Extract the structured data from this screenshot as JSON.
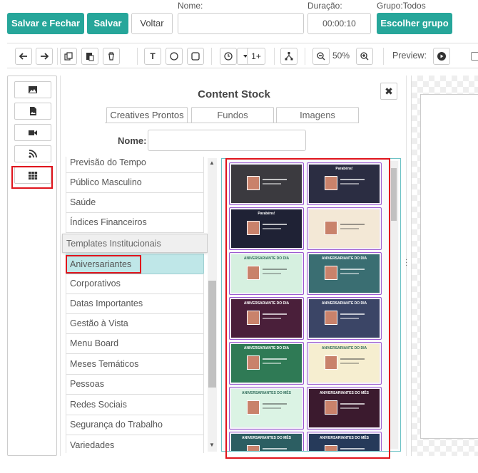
{
  "header": {
    "save_close": "Salvar e Fechar",
    "save": "Salvar",
    "back": "Voltar",
    "name_label": "Nome:",
    "name_value": "",
    "duration_label": "Duração:",
    "duration_value": "00:00:10",
    "group_label": "Grupo:Todos",
    "choose_group": "Escolher grupo"
  },
  "toolbar": {
    "text_tool": "T",
    "plus_one": "1+",
    "zoom": "50%",
    "preview_label": "Preview:"
  },
  "modal": {
    "title": "Content Stock",
    "close": "✖",
    "tabs": [
      "Creatives Prontos",
      "Fundos",
      "Imagens"
    ],
    "active_tab": "Creatives Prontos",
    "name_label": "Nome:",
    "name_value": ""
  },
  "categories": {
    "items_before": [
      "Previsão do Tempo",
      "Público Masculino",
      "Saúde",
      "Índices Financeiros"
    ],
    "group_header": "Templates Institucionais",
    "selected": "Aniversariantes",
    "items_after": [
      "Corporativos",
      "Datas Importantes",
      "Gestão à Vista",
      "Menu Board",
      "Meses Temáticos",
      "Pessoas",
      "Redes Sociais",
      "Segurança do Trabalho",
      "Variedades"
    ]
  },
  "thumbnails": [
    {
      "label": "",
      "bg": "#3b3a3f"
    },
    {
      "label": "Parabéns!",
      "bg": "#2b2d42"
    },
    {
      "label": "Parabéns!",
      "bg": "#1f2235"
    },
    {
      "label": "",
      "bg": "#f3e8d6"
    },
    {
      "label": "ANIVERSARIANTE DO DIA",
      "bg": "#d6f0e0"
    },
    {
      "label": "ANIVERSARIANTE DO DIA",
      "bg": "#3a6e72"
    },
    {
      "label": "ANIVERSARIANTE DO DIA",
      "bg": "#4a1f3a"
    },
    {
      "label": "ANIVERSARIANTE DO DIA",
      "bg": "#3b4566"
    },
    {
      "label": "ANIVERSARIANTE DO DIA",
      "bg": "#2f7a55"
    },
    {
      "label": "ANIVERSARIANTE DO DIA",
      "bg": "#f6eed0"
    },
    {
      "label": "ANIVERSARIANTES DO MÊS",
      "bg": "#dbf3e4"
    },
    {
      "label": "ANIVERSARIANTES DO MÊS",
      "bg": "#3b1a2e"
    },
    {
      "label": "ANIVERSARIANTES DO MÊS",
      "bg": "#2c5e62"
    },
    {
      "label": "ANIVERSARIANTES DO MÊS",
      "bg": "#263a5a"
    }
  ],
  "colors": {
    "accent": "#26a69a",
    "highlight": "#e0141c",
    "selected_row": "#bfe7e8",
    "thumb_border": "#9b59d0"
  }
}
